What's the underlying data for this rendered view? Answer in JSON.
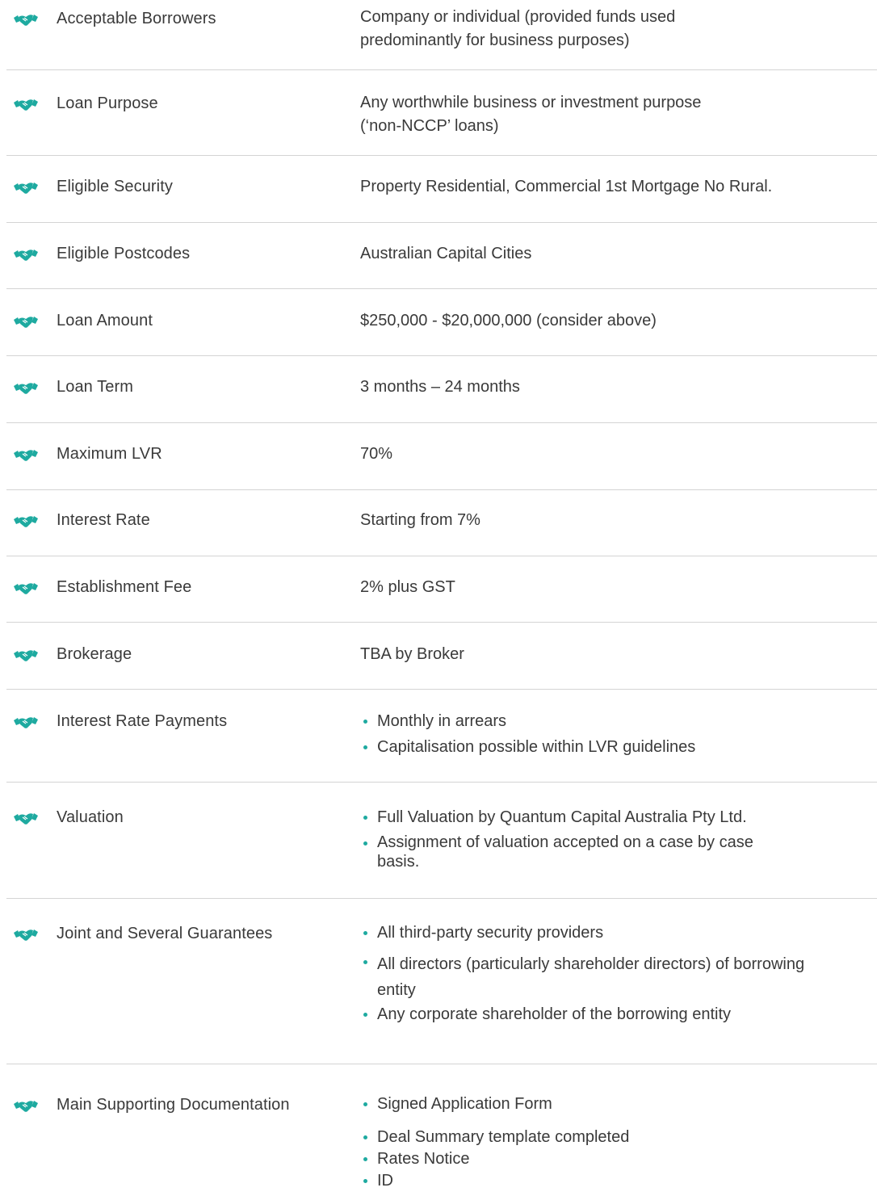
{
  "accent_color": "#1eaaa0",
  "row_icon": "handshake-icon",
  "rows": [
    {
      "label": "Acceptable Borrowers",
      "value_lines": [
        "Company or individual (provided funds used",
        "predominantly for business purposes)"
      ]
    },
    {
      "label": "Loan Purpose",
      "value_lines": [
        "Any worthwhile business or investment purpose",
        "(‘non-NCCP’ loans)"
      ]
    },
    {
      "label": "Eligible Security",
      "value_lines": [
        "Property Residential, Commercial 1st Mortgage No Rural."
      ]
    },
    {
      "label": "Eligible Postcodes",
      "value_lines": [
        "Australian Capital Cities"
      ]
    },
    {
      "label": "Loan Amount",
      "value_lines": [
        "$250,000 - $20,000,000 (consider above)"
      ]
    },
    {
      "label": "Loan Term",
      "value_lines": [
        "3 months – 24 months"
      ]
    },
    {
      "label": "Maximum LVR",
      "value_lines": [
        "70%"
      ]
    },
    {
      "label": "Interest Rate",
      "value_lines": [
        "Starting from 7%"
      ]
    },
    {
      "label": "Establishment Fee",
      "value_lines": [
        "2% plus GST"
      ]
    },
    {
      "label": "Brokerage",
      "value_lines": [
        "TBA by Broker"
      ]
    },
    {
      "label": "Interest Rate Payments",
      "bullets": [
        "Monthly in arrears",
        "Capitalisation possible within LVR guidelines"
      ]
    },
    {
      "label": "Valuation",
      "bullets": [
        "Full Valuation by Quantum Capital Australia Pty Ltd.",
        "Assignment of valuation accepted on a case by case basis."
      ]
    },
    {
      "label": "Joint and Several Guarantees",
      "bullets": [
        "All third-party security providers",
        "All directors (particularly shareholder directors) of borrowing entity",
        "Any corporate shareholder of the borrowing entity"
      ]
    },
    {
      "label": "Main Supporting Documentation",
      "bullets": [
        "Signed Application Form",
        "Deal Summary template completed",
        "Rates Notice",
        "ID"
      ]
    }
  ]
}
